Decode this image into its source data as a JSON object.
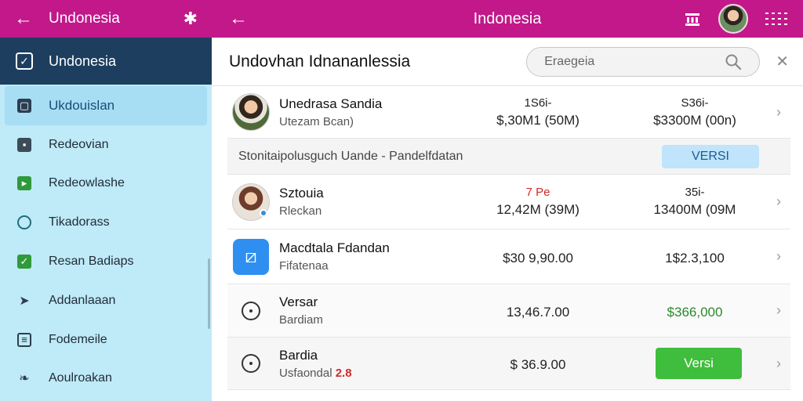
{
  "sidebar": {
    "top_title": "Undonesia",
    "back_glyph": "←",
    "gear_glyph": "✱",
    "account_label": "Undonesia",
    "items": [
      {
        "label": "Ukdouislan",
        "icon": "card-icon",
        "active": true
      },
      {
        "label": "Redeovian",
        "icon": "chart-icon"
      },
      {
        "label": "Redeowlashe",
        "icon": "flag-icon"
      },
      {
        "label": "Tikadorass",
        "icon": "search-icon"
      },
      {
        "label": "Resan Badiaps",
        "icon": "folder-check-icon"
      },
      {
        "label": "Addanlaaan",
        "icon": "send-icon"
      },
      {
        "label": "Fodemeile",
        "icon": "document-icon"
      },
      {
        "label": "Aoulroakan",
        "icon": "leaf-icon"
      }
    ]
  },
  "topbar": {
    "title": "Indonesia",
    "back_glyph": "←"
  },
  "header": {
    "title": "Undovhan Idnananlessia",
    "search_placeholder": "Eraegeia",
    "close_glyph": "✕"
  },
  "rows": [
    {
      "name": "Unedrasa Sandia",
      "sub": "Utezam Bcan)",
      "c1_small": "1S6i-",
      "c1_big": "$,30M1 (50M)",
      "c2_small": "S36i-",
      "c2_big": "$3300M (00n)"
    },
    {
      "name": "Sztouia",
      "sub": "Rleckan",
      "c1_small": "7 Pe",
      "c1_big": "12,42M (39M)",
      "c2_small": "35i-",
      "c2_big": "13400M (09M"
    },
    {
      "name": "Macdtala Fdandan",
      "sub": "Fifatenaa",
      "c1_big": "$30 9,90.00",
      "c2_big": "1$2.3,100"
    },
    {
      "name": "Versar",
      "sub": "Bardiam",
      "c1_big": "13,46.7.00",
      "c2_big": "$366,000"
    },
    {
      "name": "Bardia",
      "sub": "Usfaondal",
      "sub_badge": "2.8",
      "c1_big": "$ 36.9.00",
      "button": "Versi"
    }
  ],
  "banner": {
    "text": "Stonitaipolusguch Uande - Pandelfdatan",
    "button": "VERSI"
  },
  "chevron_glyph": "›",
  "colors": {
    "brand": "#c2188a",
    "sidebar_bg": "#bfeaf8",
    "sidebar_dark": "#1d3e5e",
    "accent_blue": "#2e8ff0",
    "success": "#3fbd3c"
  }
}
